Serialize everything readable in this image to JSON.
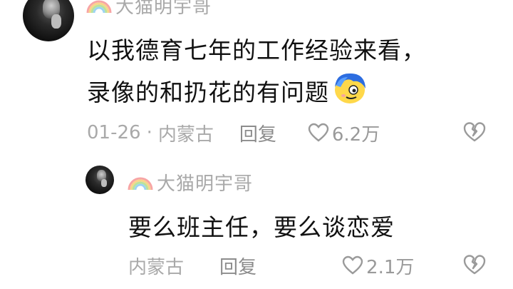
{
  "comments": [
    {
      "username": "大猫明宇哥",
      "text_line1": "以我德育七年的工作经验来看，",
      "text_line2": "录像的和扔花的有问题",
      "date": "01-26",
      "separator": "·",
      "location": "内蒙古",
      "reply_label": "回复",
      "likes": "6.2万",
      "emoji": "blue-hair-face-emoji"
    },
    {
      "username": "大猫明宇哥",
      "text": "要么班主任，要么谈恋爱",
      "location": "内蒙古",
      "reply_label": "回复",
      "likes": "2.1万"
    }
  ],
  "colors": {
    "meta_gray": "#a9a9a9",
    "text": "#111111",
    "icon_gray": "#9a9a9a"
  },
  "icons": [
    "rainbow-icon",
    "heart-icon",
    "broken-heart-icon"
  ]
}
